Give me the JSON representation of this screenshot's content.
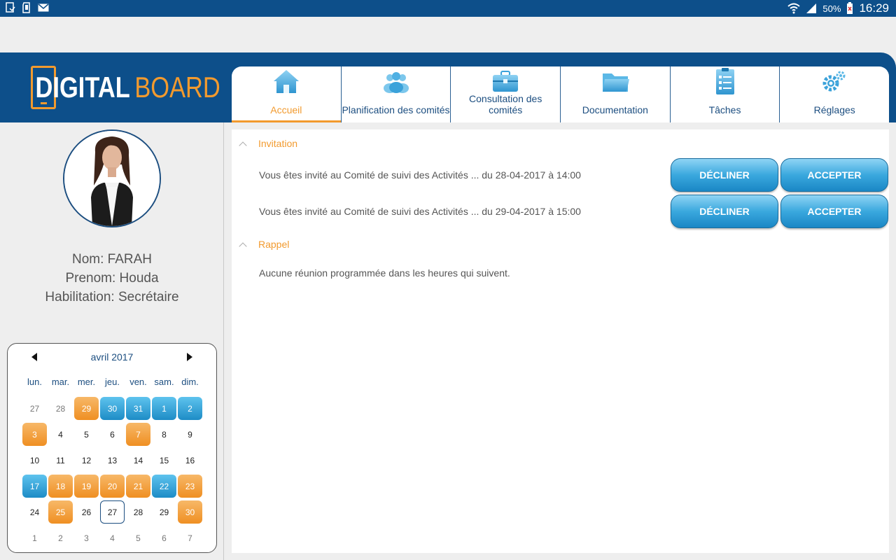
{
  "status_bar": {
    "battery": "50%",
    "time": "16:29"
  },
  "logo": {
    "part1": "DIGITAL",
    "part2": "BOARD"
  },
  "tabs": [
    {
      "label": "Accueil",
      "icon": "home-icon",
      "active": true
    },
    {
      "label": "Planification des comités",
      "icon": "people-icon",
      "active": false
    },
    {
      "label": "Consultation des comités",
      "icon": "briefcase-icon",
      "active": false
    },
    {
      "label": "Documentation",
      "icon": "folder-icon",
      "active": false
    },
    {
      "label": "Tâches",
      "icon": "checklist-icon",
      "active": false
    },
    {
      "label": "Réglages",
      "icon": "gears-icon",
      "active": false
    }
  ],
  "user": {
    "nom": "Nom: FARAH",
    "prenom": "Prenom: Houda",
    "habilitation": "Habilitation: Secrétaire"
  },
  "calendar": {
    "month_label": "avril 2017",
    "weekdays": [
      "lun.",
      "mar.",
      "mer.",
      "jeu.",
      "ven.",
      "sam.",
      "dim."
    ],
    "days": [
      {
        "n": "27",
        "s": "muted"
      },
      {
        "n": "28",
        "s": "muted"
      },
      {
        "n": "29",
        "s": "orange"
      },
      {
        "n": "30",
        "s": "blue"
      },
      {
        "n": "31",
        "s": "blue"
      },
      {
        "n": "1",
        "s": "blue"
      },
      {
        "n": "2",
        "s": "blue"
      },
      {
        "n": "3",
        "s": "orange"
      },
      {
        "n": "4",
        "s": ""
      },
      {
        "n": "5",
        "s": ""
      },
      {
        "n": "6",
        "s": ""
      },
      {
        "n": "7",
        "s": "orange"
      },
      {
        "n": "8",
        "s": ""
      },
      {
        "n": "9",
        "s": ""
      },
      {
        "n": "10",
        "s": ""
      },
      {
        "n": "11",
        "s": ""
      },
      {
        "n": "12",
        "s": ""
      },
      {
        "n": "13",
        "s": ""
      },
      {
        "n": "14",
        "s": ""
      },
      {
        "n": "15",
        "s": ""
      },
      {
        "n": "16",
        "s": ""
      },
      {
        "n": "17",
        "s": "blue"
      },
      {
        "n": "18",
        "s": "orange"
      },
      {
        "n": "19",
        "s": "orange"
      },
      {
        "n": "20",
        "s": "orange"
      },
      {
        "n": "21",
        "s": "orange"
      },
      {
        "n": "22",
        "s": "blue"
      },
      {
        "n": "23",
        "s": "orange"
      },
      {
        "n": "24",
        "s": ""
      },
      {
        "n": "25",
        "s": "orange"
      },
      {
        "n": "26",
        "s": ""
      },
      {
        "n": "27",
        "s": "today"
      },
      {
        "n": "28",
        "s": ""
      },
      {
        "n": "29",
        "s": ""
      },
      {
        "n": "30",
        "s": "orange"
      },
      {
        "n": "1",
        "s": "muted"
      },
      {
        "n": "2",
        "s": "muted"
      },
      {
        "n": "3",
        "s": "muted"
      },
      {
        "n": "4",
        "s": "muted"
      },
      {
        "n": "5",
        "s": "muted"
      },
      {
        "n": "6",
        "s": "muted"
      },
      {
        "n": "7",
        "s": "muted"
      }
    ]
  },
  "invitation": {
    "title": "Invitation",
    "items": [
      {
        "text": "Vous êtes invité au Comité de suivi des Activités ... du 28-04-2017 à 14:00",
        "decline": "DÉCLINER",
        "accept": "ACCEPTER"
      },
      {
        "text": "Vous êtes invité au Comité de suivi des Activités ... du 29-04-2017 à 15:00",
        "decline": "DÉCLINER",
        "accept": "ACCEPTER"
      }
    ]
  },
  "rappel": {
    "title": "Rappel",
    "text": "Aucune réunion programmée dans les heures qui suivent."
  },
  "colors": {
    "primary": "#0d4f8a",
    "accent": "#f29a2e",
    "button": "#3aa8de"
  }
}
